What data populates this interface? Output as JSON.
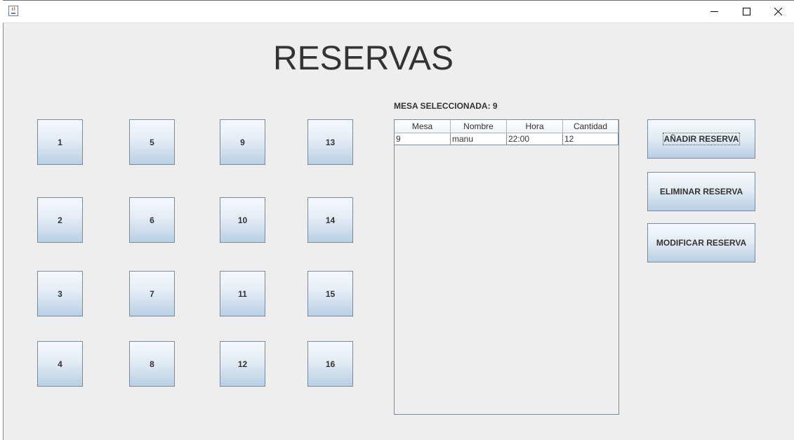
{
  "window": {
    "icon": "java-cup-icon",
    "controls": [
      "minimize-icon",
      "maximize-icon",
      "close-icon"
    ]
  },
  "heading": "RESERVAS",
  "mesas": [
    "1",
    "5",
    "9",
    "13",
    "2",
    "6",
    "10",
    "14",
    "3",
    "7",
    "11",
    "15",
    "4",
    "8",
    "12",
    "16"
  ],
  "selected_label": "MESA SELECCIONADA: 9",
  "table": {
    "headers": [
      "Mesa",
      "Nombre",
      "Hora",
      "Cantidad"
    ],
    "rows": [
      [
        "9",
        "manu",
        "22:00",
        "12"
      ]
    ]
  },
  "actions": {
    "add": "AÑADIR RESERVA",
    "delete": "ELIMINAR RESERVA",
    "modify": "MODIFICAR RESERVA"
  }
}
